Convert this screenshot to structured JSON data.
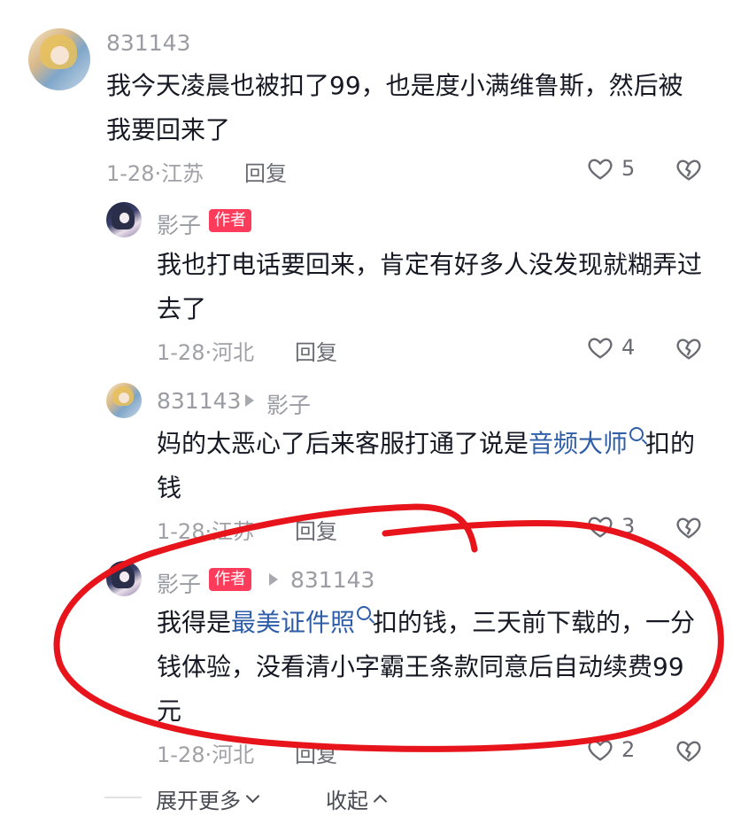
{
  "comments": [
    {
      "username": "831143",
      "text": "我今天凌晨也被扣了99，也是度小满维鲁斯，然后被我要回来了",
      "date_location": "1-28·江苏",
      "reply_label": "回复",
      "likes": "5"
    },
    {
      "username": "影子",
      "badge": "作者",
      "text": "我也打电话要回来，肯定有好多人没发现就糊弄过去了",
      "date_location": "1-28·河北",
      "reply_label": "回复",
      "likes": "4"
    },
    {
      "username": "831143",
      "reply_to": "影子",
      "text_before": "妈的太恶心了后来客服打通了说是",
      "link": "音频大师",
      "text_after": "扣的钱",
      "date_location": "1-28·江苏",
      "reply_label": "回复",
      "likes": "3"
    },
    {
      "username": "影子",
      "badge": "作者",
      "reply_to": "831143",
      "text_before": "我得是",
      "link": "最美证件照",
      "text_after": "扣的钱，三天前下载的，一分钱体验，没看清小字霸王条款同意后自动续费99元",
      "date_location": "1-28·河北",
      "reply_label": "回复",
      "likes": "2"
    }
  ],
  "footer": {
    "expand_more": "展开更多",
    "collapse": "收起"
  },
  "colors": {
    "badge": "#fd3b5b",
    "link": "#2f5ea8",
    "annotation": "#e8141c"
  }
}
